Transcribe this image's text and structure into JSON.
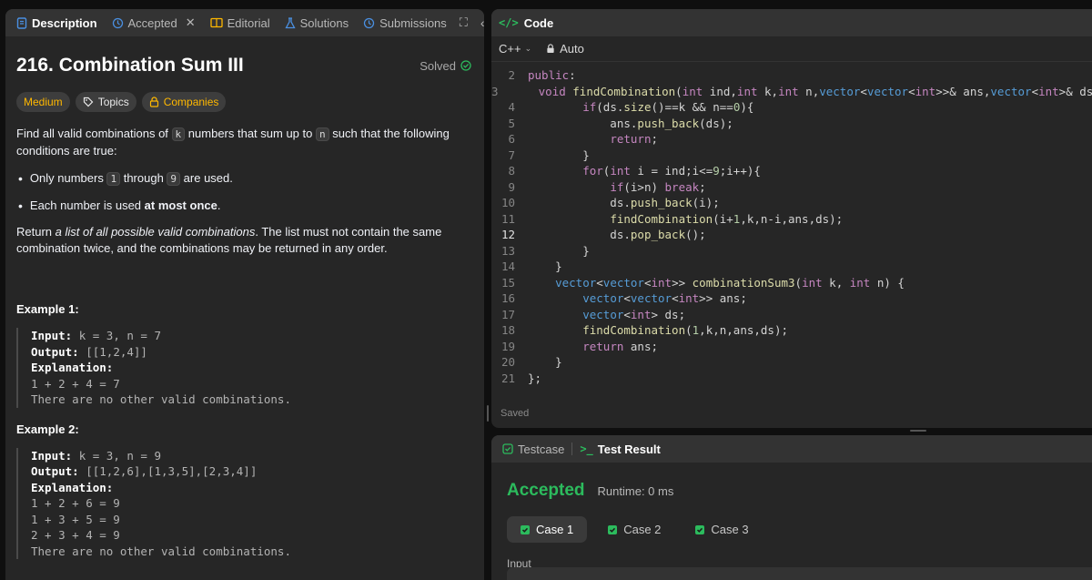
{
  "left_tabs": {
    "description": "Description",
    "accepted": "Accepted",
    "editorial": "Editorial",
    "solutions": "Solutions",
    "submissions": "Submissions"
  },
  "problem": {
    "title": "216. Combination Sum III",
    "status": "Solved",
    "tags": {
      "difficulty": "Medium",
      "topics": "Topics",
      "companies": "Companies"
    },
    "desc_1": "Find all valid combinations of",
    "var_k": "k",
    "desc_2": "numbers that sum up to",
    "var_n": "n",
    "desc_3": "such that the following conditions are true:",
    "bullet1_a": "Only numbers",
    "bullet1_1": "1",
    "bullet1_b": "through",
    "bullet1_9": "9",
    "bullet1_c": "are used.",
    "bullet2_a": "Each number is used",
    "bullet2_b": "at most once",
    "bullet2_c": ".",
    "return_a": "Return",
    "return_b": "a list of all possible valid combinations",
    "return_c": ". The list must not contain the same combination twice, and the combinations may be returned in any order.",
    "examples": [
      {
        "title": "Example 1:",
        "input_label": "Input:",
        "input": "k = 3, n = 7",
        "output_label": "Output:",
        "output": "[[1,2,4]]",
        "explanation_label": "Explanation:",
        "lines": [
          "1 + 2 + 4 = 7",
          "There are no other valid combinations."
        ]
      },
      {
        "title": "Example 2:",
        "input_label": "Input:",
        "input": "k = 3, n = 9",
        "output_label": "Output:",
        "output": "[[1,2,6],[1,3,5],[2,3,4]]",
        "explanation_label": "Explanation:",
        "lines": [
          "1 + 2 + 6 = 9",
          "1 + 3 + 5 = 9",
          "2 + 3 + 4 = 9",
          "There are no other valid combinations."
        ]
      }
    ]
  },
  "editor": {
    "title": "Code",
    "language": "C++",
    "mode": "Auto",
    "saved": "Saved",
    "current_line": 12,
    "lines": [
      {
        "n": 2,
        "t": "public:"
      },
      {
        "n": 3,
        "t": "    void findCombination(int ind,int k,int n,vector<vector<int>>& ans,vector<int>& ds){"
      },
      {
        "n": 4,
        "t": "        if(ds.size()==k && n==0){"
      },
      {
        "n": 5,
        "t": "            ans.push_back(ds);"
      },
      {
        "n": 6,
        "t": "            return;"
      },
      {
        "n": 7,
        "t": "        }"
      },
      {
        "n": 8,
        "t": "        for(int i = ind;i<=9;i++){"
      },
      {
        "n": 9,
        "t": "            if(i>n) break;"
      },
      {
        "n": 10,
        "t": "            ds.push_back(i);"
      },
      {
        "n": 11,
        "t": "            findCombination(i+1,k,n-i,ans,ds);"
      },
      {
        "n": 12,
        "t": "            ds.pop_back();"
      },
      {
        "n": 13,
        "t": "        }"
      },
      {
        "n": 14,
        "t": "    }"
      },
      {
        "n": 15,
        "t": "    vector<vector<int>> combinationSum3(int k, int n) {"
      },
      {
        "n": 16,
        "t": "        vector<vector<int>> ans;"
      },
      {
        "n": 17,
        "t": "        vector<int> ds;"
      },
      {
        "n": 18,
        "t": "        findCombination(1,k,n,ans,ds);"
      },
      {
        "n": 19,
        "t": "        return ans;"
      },
      {
        "n": 20,
        "t": "    }"
      },
      {
        "n": 21,
        "t": "};"
      }
    ]
  },
  "test": {
    "testcase_tab": "Testcase",
    "result_tab": "Test Result",
    "status": "Accepted",
    "runtime": "Runtime: 0 ms",
    "cases": [
      "Case 1",
      "Case 2",
      "Case 3"
    ],
    "input_label": "Input"
  },
  "colors": {
    "accepted": "#2cbb5d",
    "medium": "#ffb800",
    "bg": "#262626"
  }
}
